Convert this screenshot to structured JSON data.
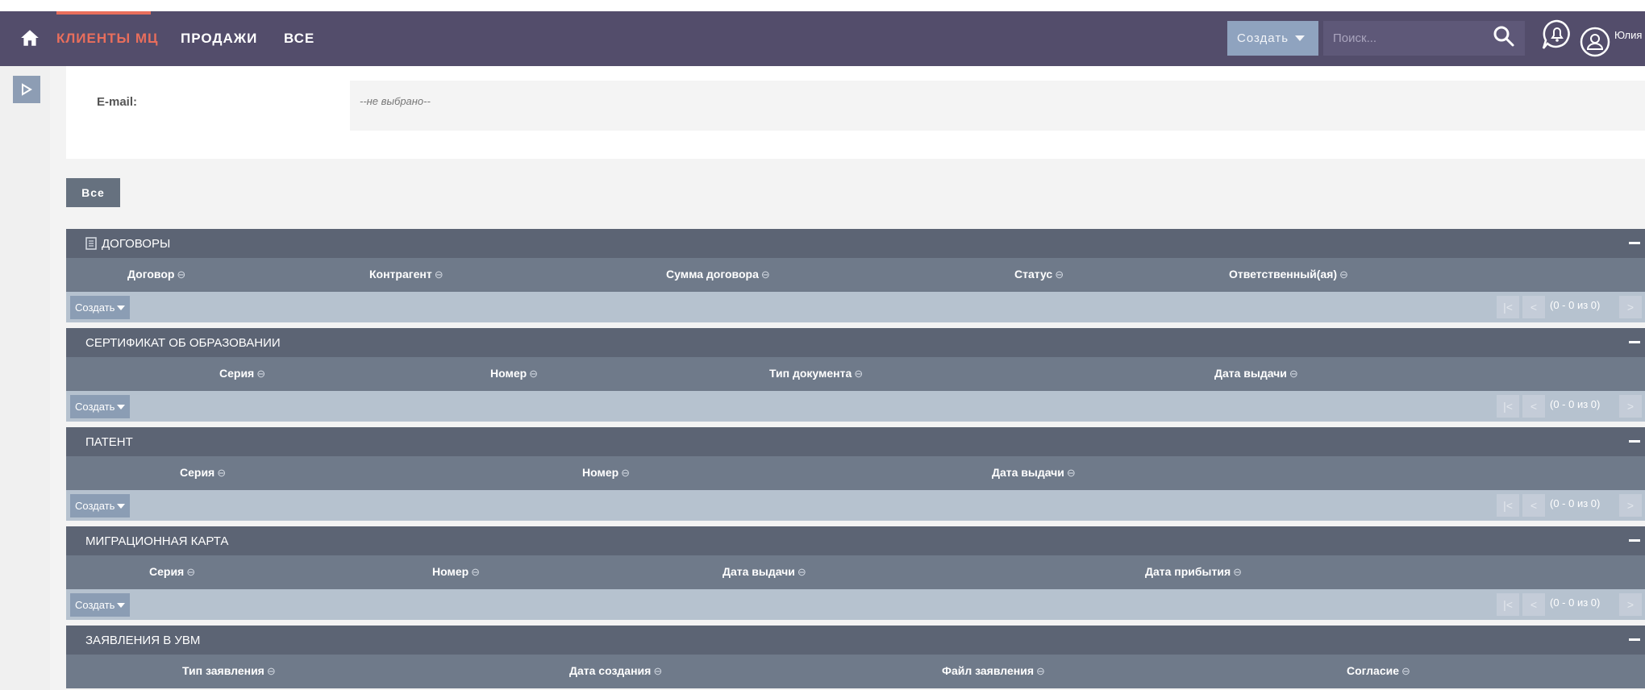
{
  "nav": {
    "tabs": [
      "КЛИЕНТЫ МЦ",
      "ПРОДАЖИ",
      "ВСЕ"
    ],
    "create_label": "Создать",
    "search_placeholder": "Поиск...",
    "user_name": "Юлия"
  },
  "email": {
    "label": "E-mail:",
    "value": "--не выбрано--"
  },
  "filter_all_label": "Все",
  "panels": [
    {
      "title": "ДОГОВОРЫ",
      "columns": [
        "Договор",
        "Контрагент",
        "Сумма договора",
        "Статус",
        "Ответственный(ая)"
      ],
      "create_label": "Создать",
      "pagination": "(0 - 0 из 0)"
    },
    {
      "title": "СЕРТИФИКАТ ОБ ОБРАЗОВАНИИ",
      "columns": [
        "Серия",
        "Номер",
        "Тип документа",
        "Дата выдачи"
      ],
      "create_label": "Создать",
      "pagination": "(0 - 0 из 0)"
    },
    {
      "title": "ПАТЕНТ",
      "columns": [
        "Серия",
        "Номер",
        "Дата выдачи"
      ],
      "create_label": "Создать",
      "pagination": "(0 - 0 из 0)"
    },
    {
      "title": "МИГРАЦИОННАЯ КАРТА",
      "columns": [
        "Серия",
        "Номер",
        "Дата выдачи",
        "Дата прибытия"
      ],
      "create_label": "Создать",
      "pagination": "(0 - 0 из 0)"
    },
    {
      "title": "ЗАЯВЛЕНИЯ В УВМ",
      "columns": [
        "Тип заявления",
        "Дата создания",
        "Файл заявления",
        "Согласие"
      ]
    }
  ],
  "icons": {
    "home": "home-icon",
    "search": "search-icon",
    "notifications": "bell-icon",
    "user": "user-icon",
    "sort": "sort-icon",
    "collapse": "minus-icon"
  },
  "colors": {
    "navbar": "#534d6b",
    "accent": "#e96e5c",
    "panel_header": "#5c6474",
    "column_header": "#6f7a8a",
    "panel_footer": "#b6c2cf"
  }
}
